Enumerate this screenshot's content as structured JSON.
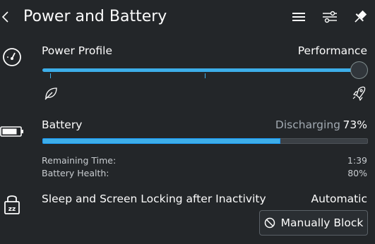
{
  "header": {
    "title": "Power and Battery"
  },
  "power_profile": {
    "label": "Power Profile",
    "value": "Performance",
    "level": 1.0
  },
  "battery": {
    "label": "Battery",
    "status": "Discharging",
    "percent_text": "73%",
    "percent": 73,
    "remaining_label": "Remaining Time:",
    "remaining_value": "1:39",
    "health_label": "Battery Health:",
    "health_value": "80%"
  },
  "sleep": {
    "label": "Sleep and Screen Locking after Inactivity",
    "value": "Automatic",
    "button_label": "Manually Block"
  },
  "colors": {
    "accent": "#3daee9",
    "background": "#232629",
    "text": "#fcfcfc"
  }
}
